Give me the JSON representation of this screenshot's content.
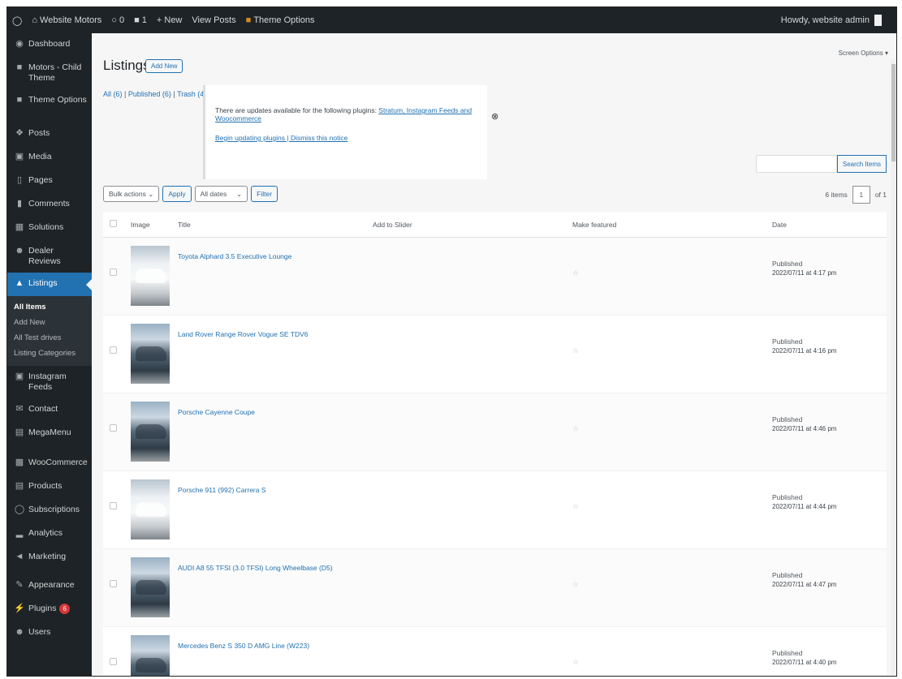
{
  "adminbar": {
    "site_name": "Website Motors",
    "comments_count": "0",
    "updates_count": "1",
    "new_label": "+ New",
    "view_posts": "View Posts",
    "theme_options": "Theme Options",
    "howdy": "Howdy, website admin"
  },
  "sidebar": {
    "items": [
      {
        "label": "Dashboard",
        "icon": "dashboard-icon"
      },
      {
        "label": "Motors - Child Theme",
        "icon": "motors-icon"
      },
      {
        "label": "Theme Options",
        "icon": "theme-options-icon"
      },
      {
        "label": "Posts",
        "icon": "pin-icon"
      },
      {
        "label": "Media",
        "icon": "media-icon"
      },
      {
        "label": "Pages",
        "icon": "pages-icon"
      },
      {
        "label": "Comments",
        "icon": "comments-icon"
      },
      {
        "label": "Solutions",
        "icon": "solutions-icon"
      },
      {
        "label": "Dealer Reviews",
        "icon": "reviews-icon"
      },
      {
        "label": "Listings",
        "icon": "listings-icon"
      }
    ],
    "submenu": [
      "All Items",
      "Add New",
      "All Test drives",
      "Listing Categories"
    ],
    "items_after": [
      {
        "label": "Instagram Feeds",
        "icon": "instagram-icon"
      },
      {
        "label": "Contact",
        "icon": "mail-icon"
      },
      {
        "label": "MegaMenu",
        "icon": "megamenu-icon"
      },
      {
        "label": "WooCommerce",
        "icon": "woocommerce-icon"
      },
      {
        "label": "Products",
        "icon": "products-icon"
      },
      {
        "label": "Subscriptions",
        "icon": "subscriptions-icon"
      },
      {
        "label": "Analytics",
        "icon": "analytics-icon"
      },
      {
        "label": "Marketing",
        "icon": "megaphone-icon"
      },
      {
        "label": "Appearance",
        "icon": "appearance-icon"
      },
      {
        "label": "Plugins",
        "icon": "plugins-icon",
        "badge": "6"
      },
      {
        "label": "Users",
        "icon": "users-icon"
      }
    ]
  },
  "page": {
    "title": "Listings",
    "add_new": "Add New",
    "screen_options": "Screen Options ▾",
    "views_all": "All (6)",
    "views_published": "Published (6)",
    "views_trash": "Trash (4)",
    "notice_text": "There are updates available for the following plugins: ",
    "notice_links": "Stratum, Instagram Feeds and Woocommerce",
    "notice_action": "Begin updating plugins | Dismiss this notice",
    "search_button": "Search Items"
  },
  "tablenav": {
    "bulk_actions": "Bulk actions",
    "apply": "Apply",
    "all_dates": "All dates",
    "filter": "Filter",
    "items_count": "6 items",
    "page": "1",
    "of_pages": "of 1"
  },
  "table": {
    "headers": {
      "image": "Image",
      "title": "Title",
      "slider": "Add to Slider",
      "featured": "Make featured",
      "date": "Date"
    },
    "rows": [
      {
        "title": "Toyota Alphard 3.5 Executive Lounge",
        "status": "Published",
        "date": "2022/07/11 at 4:17 pm"
      },
      {
        "title": "Land Rover Range Rover Vogue SE TDV6",
        "status": "Published",
        "date": "2022/07/11 at 4:16 pm"
      },
      {
        "title": "Porsche Cayenne Coupe",
        "status": "Published",
        "date": "2022/07/11 at 4:46 pm"
      },
      {
        "title": "Porsche 911 (992) Carrera S",
        "status": "Published",
        "date": "2022/07/11 at 4:44 pm"
      },
      {
        "title": "AUDI A8 55 TFSI (3.0 TFSI) Long Wheelbase (D5)",
        "status": "Published",
        "date": "2022/07/11 at 4:47 pm"
      },
      {
        "title": "Mercedes Benz S 350 D AMG Line (W223)",
        "status": "Published",
        "date": "2022/07/11 at 4:40 pm"
      }
    ]
  }
}
